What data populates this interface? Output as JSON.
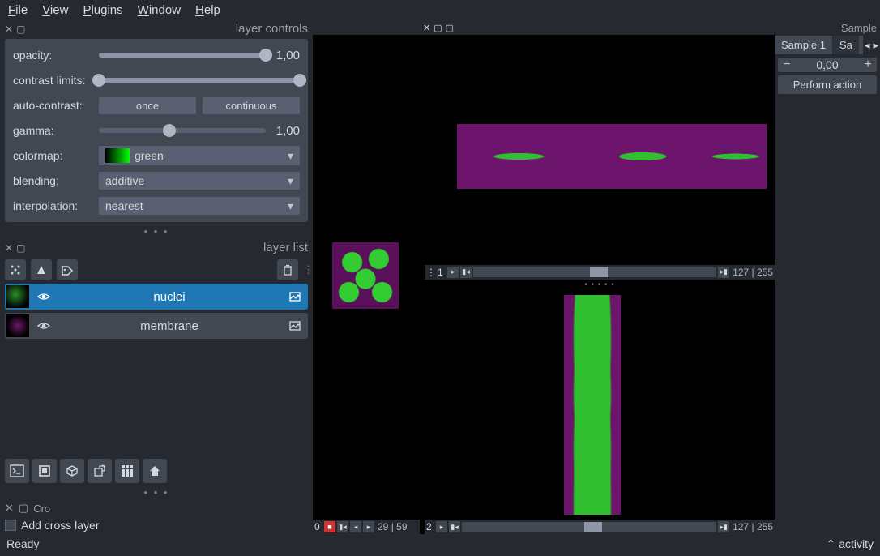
{
  "menubar": {
    "file": "File",
    "view": "View",
    "plugins": "Plugins",
    "window": "Window",
    "help": "Help"
  },
  "layer_controls": {
    "title": "layer controls",
    "opacity": {
      "label": "opacity:",
      "value": "1,00"
    },
    "contrast": {
      "label": "contrast limits:"
    },
    "auto": {
      "label": "auto-contrast:",
      "once": "once",
      "cont": "continuous"
    },
    "gamma": {
      "label": "gamma:",
      "value": "1,00"
    },
    "colormap": {
      "label": "colormap:",
      "value": "green"
    },
    "blending": {
      "label": "blending:",
      "value": "additive"
    },
    "interp": {
      "label": "interpolation:",
      "value": "nearest"
    }
  },
  "layer_list": {
    "title": "layer list",
    "items": [
      {
        "name": "nuclei"
      },
      {
        "name": "membrane"
      }
    ]
  },
  "cross": {
    "cro": "Cro",
    "add": "Add cross layer"
  },
  "viewers": {
    "top_right": {
      "curr": "127",
      "max": "255",
      "axis": "1"
    },
    "bot_left": {
      "curr": "29",
      "max": "59",
      "axis": "0"
    },
    "bot_right": {
      "curr": "127",
      "max": "255",
      "axis": "2"
    }
  },
  "sample": {
    "title": "Sample",
    "tab1": "Sample 1",
    "tab2": "Sa",
    "value": "0,00",
    "action": "Perform action"
  },
  "status": {
    "ready": "Ready",
    "activity": "activity"
  }
}
